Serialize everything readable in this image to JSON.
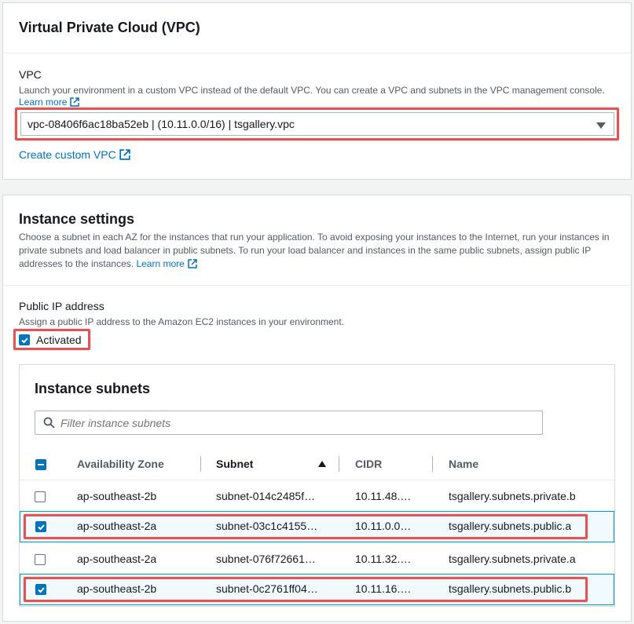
{
  "vpc_panel": {
    "title": "Virtual Private Cloud (VPC)",
    "field_label": "VPC",
    "description": "Launch your environment in a custom VPC instead of the default VPC. You can create a VPC and subnets in the VPC management console.",
    "learn_more": "Learn more",
    "selected_vpc": "vpc-08406f6ac18ba52eb | (10.11.0.0/16) | tsgallery.vpc",
    "create_link": "Create custom VPC"
  },
  "instance_panel": {
    "title": "Instance settings",
    "description": "Choose a subnet in each AZ for the instances that run your application. To avoid exposing your instances to the Internet, run your instances in private subnets and load balancer in public subnets. To run your load balancer and instances in the same public subnets, assign public IP addresses to the instances.",
    "learn_more": "Learn more",
    "public_ip": {
      "label": "Public IP address",
      "description": "Assign a public IP address to the Amazon EC2 instances in your environment.",
      "checkbox_label": "Activated",
      "checked": true
    },
    "subnets": {
      "title": "Instance subnets",
      "filter_placeholder": "Filter instance subnets",
      "columns": {
        "az": "Availability Zone",
        "subnet": "Subnet",
        "cidr": "CIDR",
        "name": "Name"
      },
      "rows": [
        {
          "az": "ap-southeast-2b",
          "subnet": "subnet-014c2485f…",
          "cidr": "10.11.48.…",
          "name": "tsgallery.subnets.private.b",
          "checked": false
        },
        {
          "az": "ap-southeast-2a",
          "subnet": "subnet-03c1c4155…",
          "cidr": "10.11.0.0…",
          "name": "tsgallery.subnets.public.a",
          "checked": true
        },
        {
          "az": "ap-southeast-2a",
          "subnet": "subnet-076f72661…",
          "cidr": "10.11.32.…",
          "name": "tsgallery.subnets.private.a",
          "checked": false
        },
        {
          "az": "ap-southeast-2b",
          "subnet": "subnet-0c2761ff04…",
          "cidr": "10.11.16.…",
          "name": "tsgallery.subnets.public.b",
          "checked": true
        }
      ]
    }
  },
  "colors": {
    "link": "#0073bb",
    "highlight": "#e05656",
    "selected_row": "#f1faff"
  }
}
